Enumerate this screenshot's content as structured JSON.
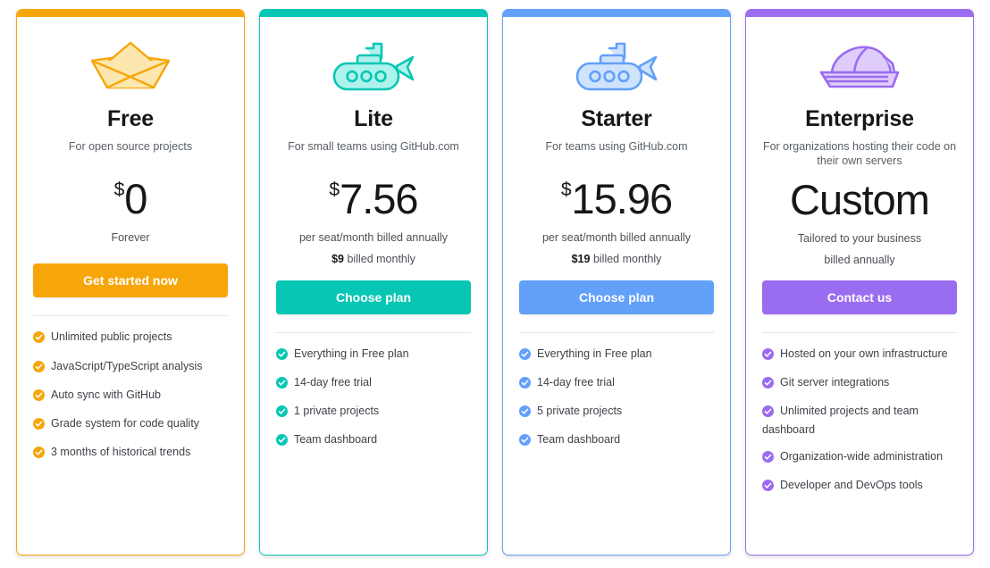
{
  "page": {
    "title": "Pricing plans",
    "background": "#ffffff"
  },
  "plans": [
    {
      "id": "free",
      "name": "Free",
      "tagline": "For open source projects",
      "icon": "paper-boat-icon",
      "accent": "#F6A609",
      "icon_fill": "#FCE7AE",
      "price_currency": "$",
      "price_amount": "0",
      "price_note": "Forever",
      "price_note_2": "",
      "price_note_2_bold": "",
      "cta_label": "Get started now",
      "features": [
        "Unlimited public projects",
        "JavaScript/TypeScript analysis",
        "Auto sync with GitHub",
        "Grade system for code quality",
        "3 months of historical trends"
      ]
    },
    {
      "id": "lite",
      "name": "Lite",
      "tagline": "For small teams using GitHub.com",
      "icon": "submarine-icon",
      "accent": "#08C6B4",
      "icon_fill": "#AEF2EC",
      "price_currency": "$",
      "price_amount": "7.56",
      "price_note": "per seat/month billed annually",
      "price_note_2_bold": "$9",
      "price_note_2": " billed monthly",
      "cta_label": "Choose plan",
      "features": [
        "Everything in Free plan",
        "14-day free trial",
        "1 private projects",
        "Team dashboard"
      ]
    },
    {
      "id": "starter",
      "name": "Starter",
      "tagline": "For teams using GitHub.com",
      "icon": "submarine-icon",
      "accent": "#62A0FA",
      "icon_fill": "#CFE3FD",
      "price_currency": "$",
      "price_amount": "15.96",
      "price_note": "per seat/month billed annually",
      "price_note_2_bold": "$19",
      "price_note_2": " billed monthly",
      "cta_label": "Choose plan",
      "features": [
        "Everything in Free plan",
        "14-day free trial",
        "5 private projects",
        "Team dashboard"
      ]
    },
    {
      "id": "enterprise",
      "name": "Enterprise",
      "tagline": "For organizations hosting their code on their own servers",
      "icon": "carrier-ship-icon",
      "accent": "#9A6CF0",
      "icon_fill": "#DECDFB",
      "price_currency": "",
      "price_amount": "Custom",
      "price_note": "Tailored to your business",
      "price_note_2_bold": "",
      "price_note_2": "billed annually",
      "cta_label": "Contact us",
      "features": [
        "Hosted on your own infrastructure",
        "Git server integrations",
        "Unlimited projects and team dashboard",
        "Organization-wide administration",
        "Developer and DevOps tools"
      ]
    }
  ]
}
